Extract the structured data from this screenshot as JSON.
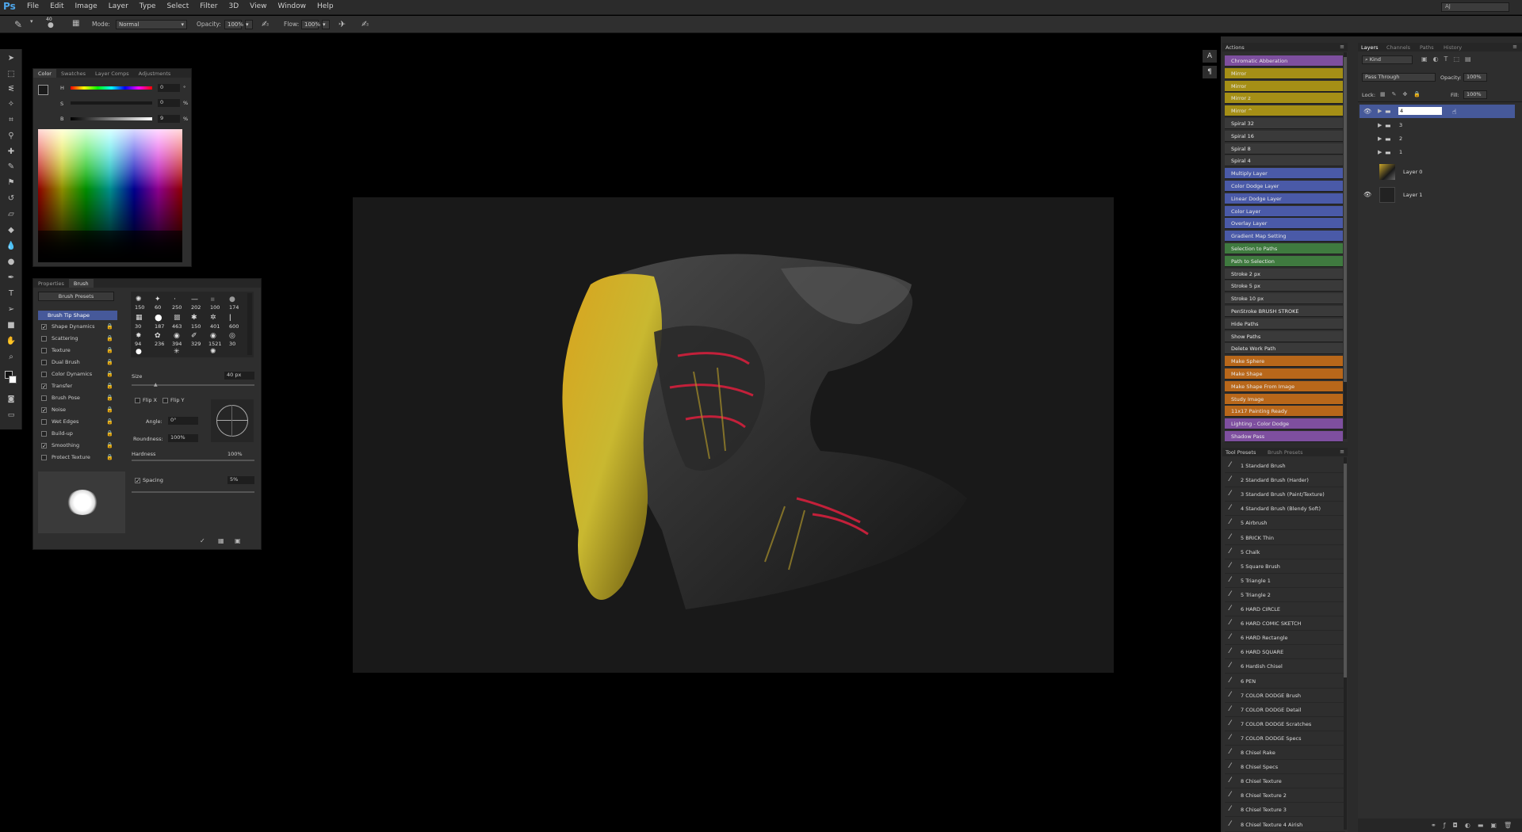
{
  "app": {
    "logo": "Ps",
    "workspace": "AJ"
  },
  "menu": [
    "File",
    "Edit",
    "Image",
    "Layer",
    "Type",
    "Select",
    "Filter",
    "3D",
    "View",
    "Window",
    "Help"
  ],
  "options": {
    "brush_size": "40",
    "mode_label": "Mode:",
    "mode_value": "Normal",
    "opacity_label": "Opacity:",
    "opacity_value": "100%",
    "flow_label": "Flow:",
    "flow_value": "100%"
  },
  "color_panel": {
    "tabs": [
      "Color",
      "Swatches",
      "Layer Comps",
      "Adjustments"
    ],
    "sliders": [
      {
        "label": "H",
        "value": "0",
        "unit": "°"
      },
      {
        "label": "S",
        "value": "0",
        "unit": "%"
      },
      {
        "label": "B",
        "value": "9",
        "unit": "%"
      }
    ]
  },
  "brush_panel": {
    "tabs": [
      "Properties",
      "Brush"
    ],
    "presets_button": "Brush Presets",
    "options": [
      {
        "label": "Brush Tip Shape",
        "checked": null,
        "active": true
      },
      {
        "label": "Shape Dynamics",
        "checked": true
      },
      {
        "label": "Scattering",
        "checked": false
      },
      {
        "label": "Texture",
        "checked": false
      },
      {
        "label": "Dual Brush",
        "checked": false
      },
      {
        "label": "Color Dynamics",
        "checked": false
      },
      {
        "label": "Transfer",
        "checked": true
      },
      {
        "label": "Brush Pose",
        "checked": false
      },
      {
        "label": "Noise",
        "checked": true
      },
      {
        "label": "Wet Edges",
        "checked": false
      },
      {
        "label": "Build-up",
        "checked": false
      },
      {
        "label": "Smoothing",
        "checked": true
      },
      {
        "label": "Protect Texture",
        "checked": false
      }
    ],
    "tip_sizes": [
      "150",
      "60",
      "250",
      "202",
      "100",
      "174",
      "30",
      "187",
      "463",
      "150",
      "401",
      "600",
      "94",
      "236",
      "394",
      "329",
      "1521",
      "30"
    ],
    "size_label": "Size",
    "size_value": "40 px",
    "flip_x": "Flip X",
    "flip_y": "Flip Y",
    "angle_label": "Angle:",
    "angle_value": "0°",
    "roundness_label": "Roundness:",
    "roundness_value": "100%",
    "hardness_label": "Hardness",
    "hardness_value": "100%",
    "spacing_label": "Spacing",
    "spacing_value": "5%"
  },
  "actions_panel": {
    "title": "Actions",
    "items": [
      {
        "label": "Chromatic Abberation",
        "color": "#7e4f9f"
      },
      {
        "label": "Mirror",
        "color": "#a58f16"
      },
      {
        "label": "Mirror",
        "color": "#a58f16"
      },
      {
        "label": "Mirror z",
        "color": "#a58f16"
      },
      {
        "label": "Mirror ^",
        "color": "#a58f16"
      },
      {
        "label": "Spiral 32",
        "color": "#3a3a3a"
      },
      {
        "label": "Spiral 16",
        "color": "#3a3a3a"
      },
      {
        "label": "Spiral 8",
        "color": "#3a3a3a"
      },
      {
        "label": "Spiral 4",
        "color": "#3a3a3a"
      },
      {
        "label": "Multiply Layer",
        "color": "#4a5aa8"
      },
      {
        "label": "Color Dodge Layer",
        "color": "#4a5aa8"
      },
      {
        "label": "Linear Dodge Layer",
        "color": "#4a5aa8"
      },
      {
        "label": "Color Layer",
        "color": "#4a5aa8"
      },
      {
        "label": "Overlay Layer",
        "color": "#4a5aa8"
      },
      {
        "label": "Gradient Map Setting",
        "color": "#4a5aa8"
      },
      {
        "label": "Selection to Paths",
        "color": "#3f7a3f"
      },
      {
        "label": "Path to Selection",
        "color": "#3f7a3f"
      },
      {
        "label": "Stroke 2 px",
        "color": "#3a3a3a"
      },
      {
        "label": "Stroke 5 px",
        "color": "#3a3a3a"
      },
      {
        "label": "Stroke 10 px",
        "color": "#3a3a3a"
      },
      {
        "label": "PenStroke BRUSH STROKE",
        "color": "#3a3a3a"
      },
      {
        "label": "Hide Paths",
        "color": "#3a3a3a"
      },
      {
        "label": "Show Paths",
        "color": "#3a3a3a"
      },
      {
        "label": "Delete Work Path",
        "color": "#3a3a3a"
      },
      {
        "label": "Make Sphere",
        "color": "#b8671a"
      },
      {
        "label": "Make Shape",
        "color": "#b8671a"
      },
      {
        "label": "Make Shape From Image",
        "color": "#b8671a"
      },
      {
        "label": "Study Image",
        "color": "#b8671a"
      },
      {
        "label": "11x17 Painting Ready",
        "color": "#b8671a"
      },
      {
        "label": "Lighting - Color Dodge",
        "color": "#7e4f9f"
      },
      {
        "label": "Shadow Pass",
        "color": "#7e4f9f"
      }
    ]
  },
  "tool_presets": {
    "tabs": [
      "Tool Presets",
      "Brush Presets"
    ],
    "items": [
      "1 Standard Brush",
      "2 Standard Brush (Harder)",
      "3 Standard Brush (Paint/Texture)",
      "4 Standard Brush (Blendy Soft)",
      "5 Airbrush",
      "5 BRICK Thin",
      "5 Chalk",
      "5 Square Brush",
      "5 Triangle 1",
      "5 Triangle 2",
      "6 HARD CIRCLE",
      "6 HARD COMIC SKETCH",
      "6 HARD Rectangle",
      "6 HARD SQUARE",
      "6 Hardish Chisel",
      "6 PEN",
      "7 COLOR DODGE Brush",
      "7 COLOR DODGE Detail",
      "7 COLOR DODGE Scratches",
      "7 COLOR DODGE Specs",
      "8 Chisel Rake",
      "8 Chisel Specs",
      "8 Chisel Texture",
      "8 Chisel Texture 2",
      "8 Chisel Texture 3",
      "8 Chisel Texture 4 Airish"
    ]
  },
  "layers_panel": {
    "tabs": [
      "Layers",
      "Channels",
      "Paths",
      "History"
    ],
    "kind": "Kind",
    "blend_mode": "Pass Through",
    "opacity_label": "Opacity:",
    "opacity_value": "100%",
    "lock_label": "Lock:",
    "fill_label": "Fill:",
    "fill_value": "100%",
    "layers": [
      {
        "name": "4",
        "type": "group",
        "visible": true,
        "selected": true
      },
      {
        "name": "3",
        "type": "group",
        "visible": false,
        "selected": false
      },
      {
        "name": "2",
        "type": "group",
        "visible": false,
        "selected": false
      },
      {
        "name": "1",
        "type": "group",
        "visible": false,
        "selected": false
      },
      {
        "name": "Layer 0",
        "type": "image",
        "visible": false,
        "selected": false
      },
      {
        "name": "Layer 1",
        "type": "fill",
        "visible": true,
        "selected": false
      }
    ]
  }
}
